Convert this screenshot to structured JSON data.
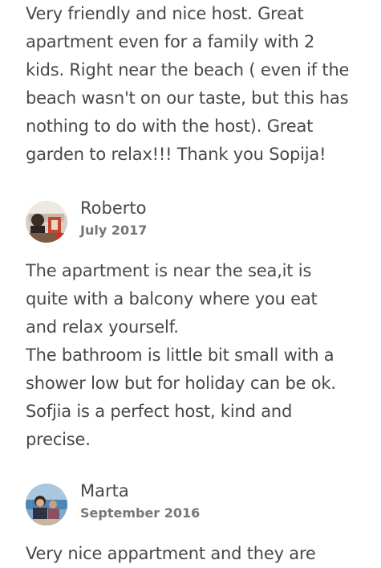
{
  "reviews": [
    {
      "lines": [
        "Very friendly and nice host. Great",
        "apartment even for a family with 2",
        "kids. Right near the beach ( even if the",
        "beach wasn't on our taste, but this has",
        "nothing to do with the host). Great",
        "garden to relax!!! Thank you Sopija!"
      ]
    },
    {
      "name": "Roberto",
      "date": "July 2017",
      "avatar": "reviewer-photo-roberto",
      "lines": [
        "The apartment is near the sea,it is",
        "quite with a balcony where you eat",
        "and relax yourself.",
        "The bathroom is little bit small with a",
        "shower low but for holiday can be ok.",
        "Sofjia is a perfect host, kind and",
        "precise."
      ]
    },
    {
      "name": "Marta",
      "date": "September 2016",
      "avatar": "reviewer-photo-marta",
      "lines": [
        "Very nice appartment and they are"
      ]
    }
  ],
  "colors": {
    "text": "#484848",
    "date": "#767676",
    "background": "#ffffff"
  }
}
